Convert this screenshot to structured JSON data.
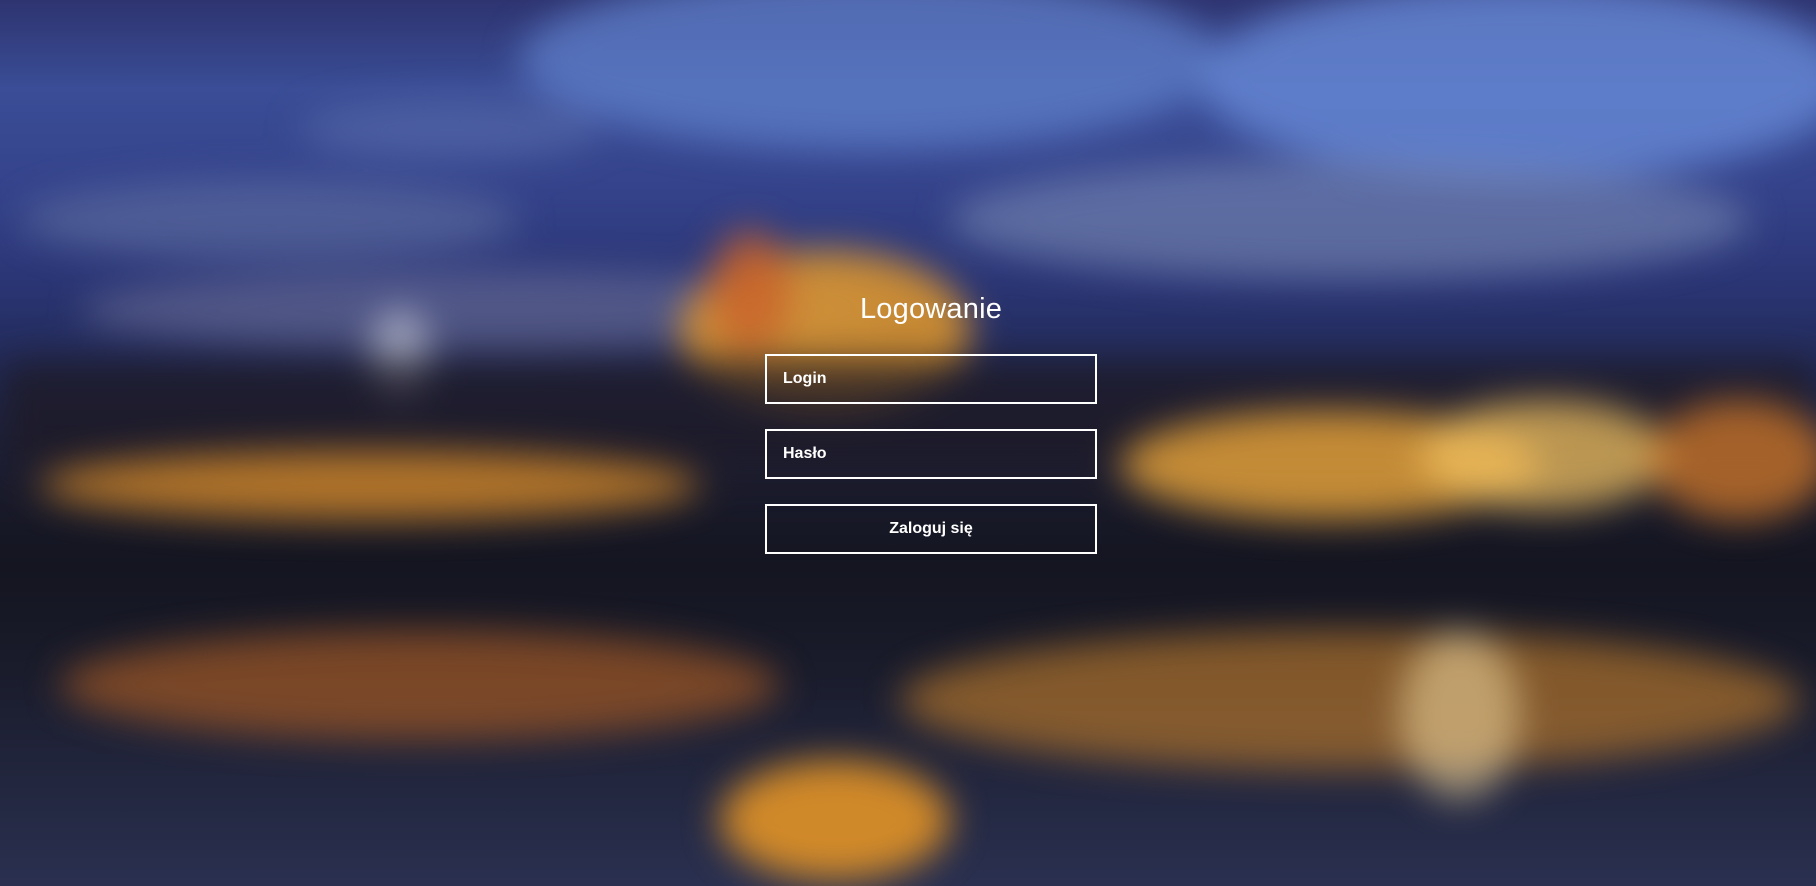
{
  "login_form": {
    "title": "Logowanie",
    "login_placeholder": "Login",
    "password_placeholder": "Hasło",
    "submit_label": "Zaloguj się"
  },
  "colors": {
    "text": "#ffffff",
    "border": "#ffffff",
    "sky": "#3a4d96",
    "lights": "#f0a030",
    "water": "#141520"
  }
}
